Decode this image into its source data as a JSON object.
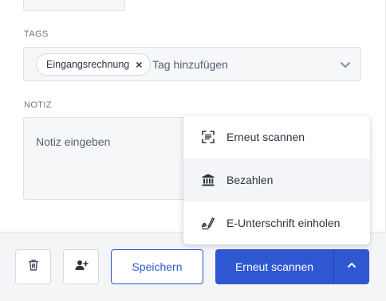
{
  "tags": {
    "label": "TAGS",
    "chips": [
      {
        "label": "Eingangsrechnung",
        "remove_glyph": "×"
      }
    ],
    "input_placeholder": "Tag hinzufügen",
    "dropdown_icon": "chevron-down-icon"
  },
  "notiz": {
    "label": "NOTIZ",
    "placeholder": "Notiz eingeben"
  },
  "menu": {
    "items": [
      {
        "label": "Erneut scannen",
        "icon": "scan-icon"
      },
      {
        "label": "Bezahlen",
        "icon": "bank-icon"
      },
      {
        "label": "E-Unterschrift einholen",
        "icon": "signature-icon"
      }
    ]
  },
  "footer": {
    "delete_icon": "trash-icon",
    "assign_icon": "add-user-icon",
    "save_label": "Speichern",
    "primary_label": "Erneut scannen",
    "toggle_icon": "chevron-up-icon"
  },
  "colors": {
    "primary": "#2f57d1",
    "field_bg": "#f6f7f9",
    "footer_bg": "#f4f5f7",
    "menu_hover": "#f4f5f8"
  }
}
